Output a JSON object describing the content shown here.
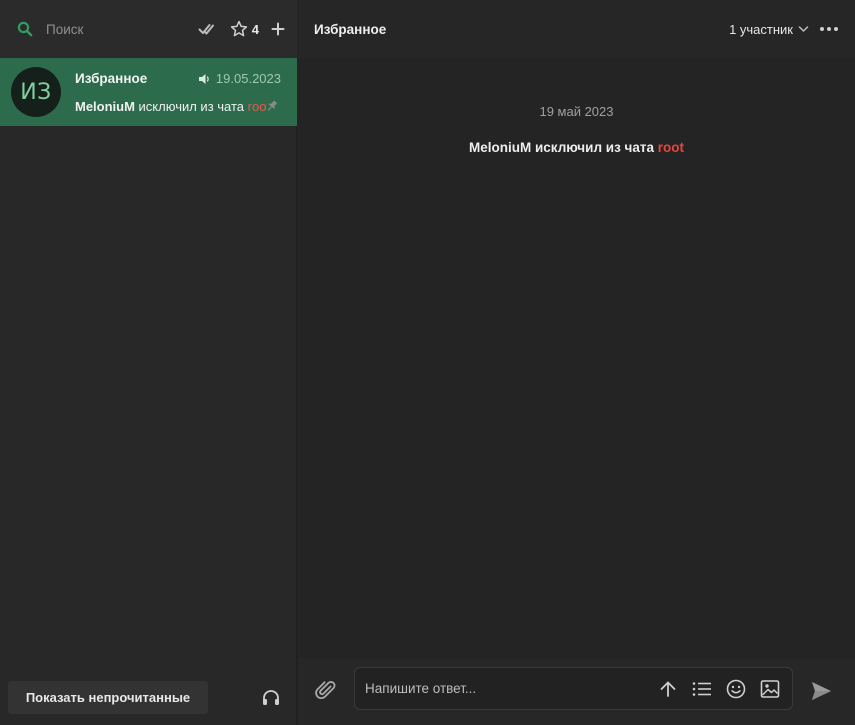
{
  "colors": {
    "accent": "#2e9e63",
    "selected_chat_bg": "#2c6b4b",
    "mention_red": "#e8453c",
    "background": "#242424"
  },
  "sidebar": {
    "search": {
      "placeholder": "Поиск",
      "icon": "search-icon"
    },
    "favorites_count": "4",
    "icons": [
      "double-check-icon",
      "star-icon",
      "plus-icon"
    ],
    "chats": [
      {
        "avatar_text": "ИЗ",
        "title": "Избранное",
        "date": "19.05.2023",
        "muted_icon": "speaker-icon",
        "preview_actor": "MeloniuM",
        "preview_text": " исключил из чата ",
        "preview_target": "root",
        "pinned_icon": "pin-icon"
      }
    ],
    "show_unread_label": "Показать непрочитанные",
    "headphones_icon": "headphones-icon"
  },
  "main": {
    "title": "Избранное",
    "participants_label": "1 участник",
    "date_divider": "19 май 2023",
    "system_message": {
      "actor": "MeloniuM",
      "text": " исключил из чата ",
      "target": "root"
    },
    "composer": {
      "placeholder": "Напишите ответ...",
      "tool_icons": [
        "arrow-up-icon",
        "list-icon",
        "emoji-icon",
        "image-icon"
      ],
      "attach_icon": "paperclip-icon",
      "send_icon": "send-icon"
    }
  }
}
